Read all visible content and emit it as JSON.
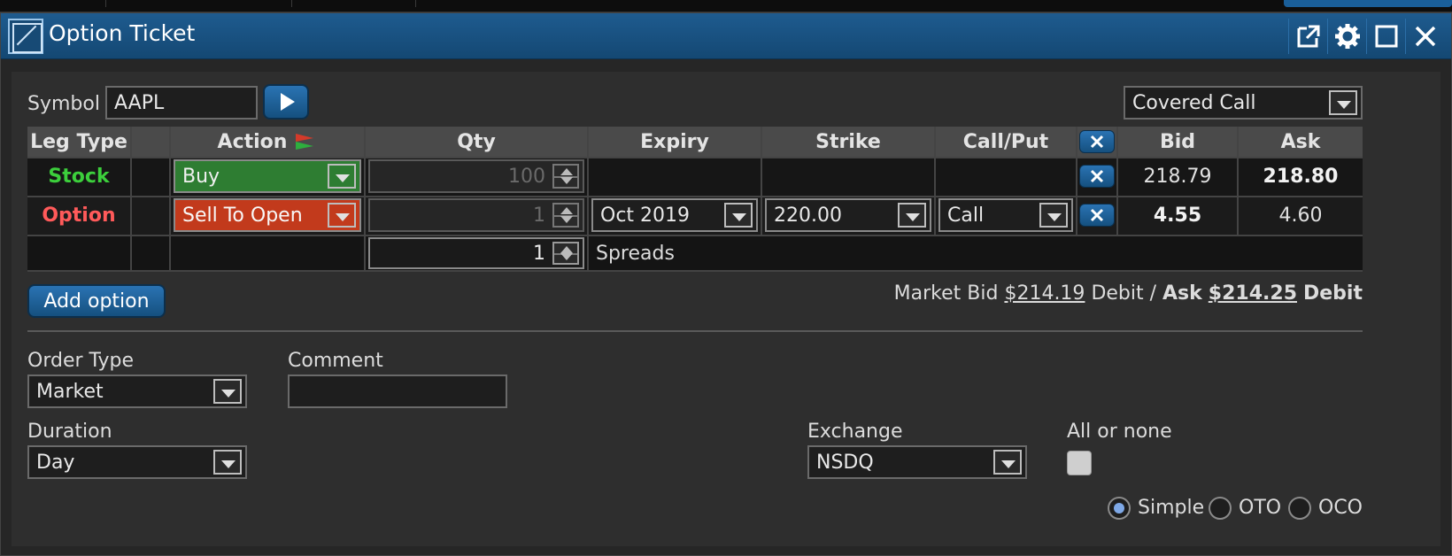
{
  "window": {
    "title": "Option Ticket"
  },
  "symbol": {
    "label": "Symbol",
    "value": "AAPL"
  },
  "strategy": {
    "value": "Covered Call"
  },
  "grid": {
    "headers": {
      "leg_type": "Leg Type",
      "action": "Action",
      "qty": "Qty",
      "expiry": "Expiry",
      "strike": "Strike",
      "call_put": "Call/Put",
      "bid": "Bid",
      "ask": "Ask"
    },
    "rows": [
      {
        "leg_type": "Stock",
        "action": "Buy",
        "qty": "100",
        "expiry": "",
        "strike": "",
        "call_put": "",
        "bid": "218.79",
        "ask": "218.80"
      },
      {
        "leg_type": "Option",
        "action": "Sell To Open",
        "qty": "1",
        "expiry": "Oct 2019",
        "strike": "220.00",
        "call_put": "Call",
        "bid": "4.55",
        "ask": "4.60"
      }
    ],
    "spread_qty": "1",
    "spread_label": "Spreads"
  },
  "add_option_label": "Add option",
  "market": {
    "bid_label": "Market Bid",
    "bid_value": "$214.19",
    "bid_suffix": "Debit /",
    "ask_label": "Ask",
    "ask_value": "$214.25",
    "ask_suffix": "Debit"
  },
  "order_type": {
    "label": "Order Type",
    "value": "Market"
  },
  "comment": {
    "label": "Comment",
    "value": ""
  },
  "duration": {
    "label": "Duration",
    "value": "Day"
  },
  "exchange": {
    "label": "Exchange",
    "value": "NSDQ"
  },
  "all_or_none": {
    "label": "All or none",
    "checked": false
  },
  "order_modes": {
    "simple": "Simple",
    "oto": "OTO",
    "oco": "OCO",
    "selected": "Simple"
  },
  "colors": {
    "stock": "#3ccf3c",
    "option": "#ff5a5a",
    "buy_bg": "#2e7d32",
    "sell_bg": "#c23a1c",
    "accent": "#1e5b8f"
  }
}
